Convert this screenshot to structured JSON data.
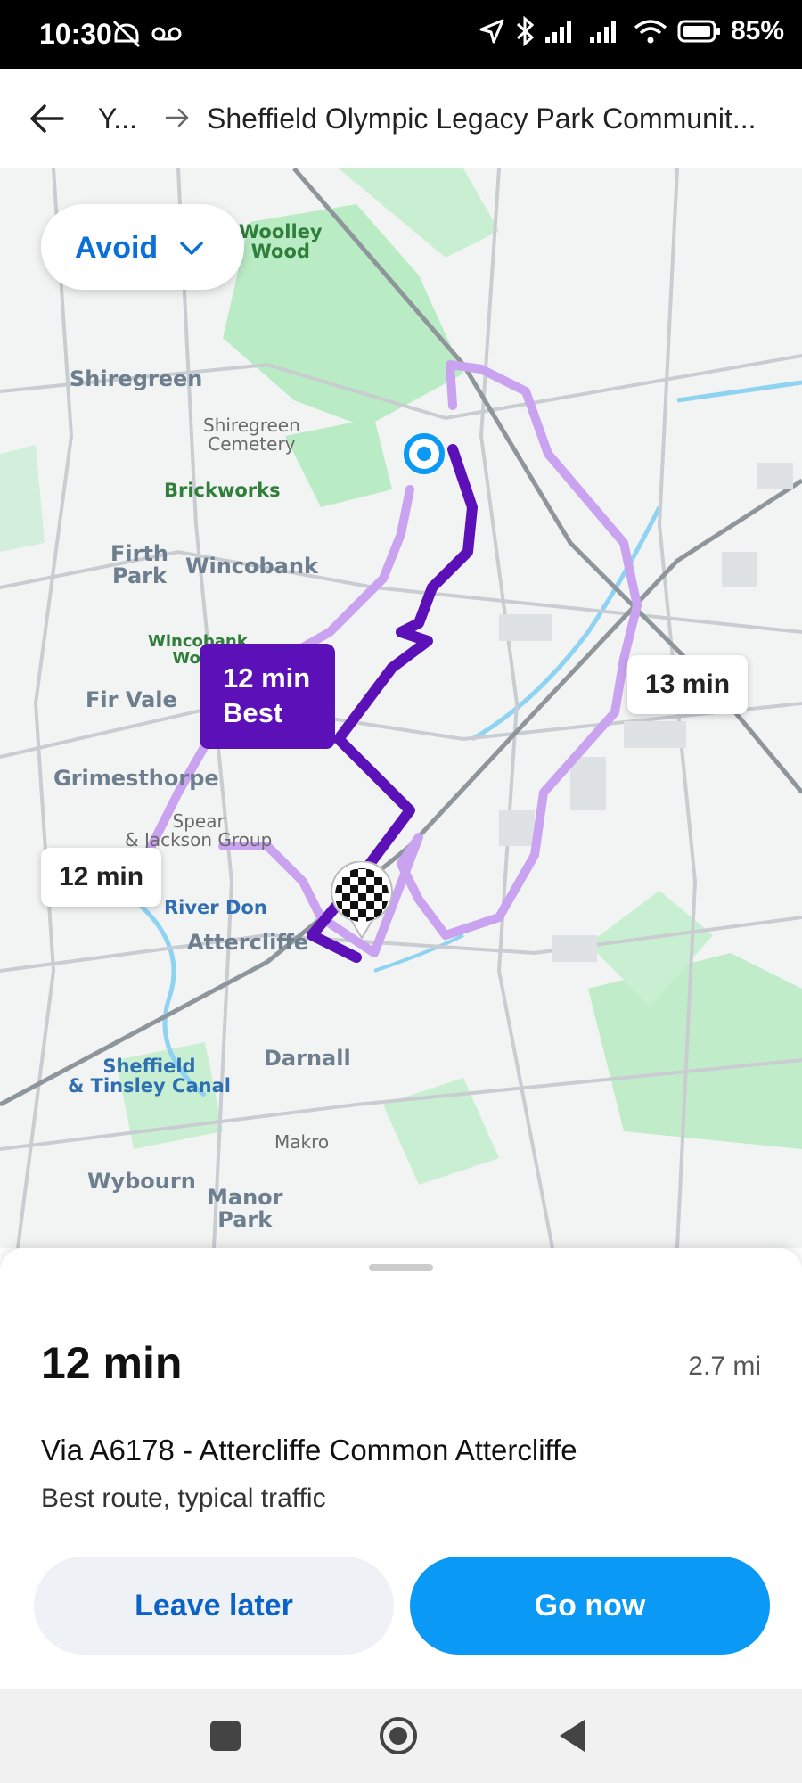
{
  "status_bar": {
    "time": "10:30",
    "battery_percent": "85%",
    "icons": [
      "alarm-off-icon",
      "voicemail-icon",
      "location-arrow-icon",
      "bluetooth-icon",
      "signal-icon",
      "signal-icon",
      "wifi-icon",
      "battery-icon"
    ]
  },
  "header": {
    "origin": "Y...",
    "destination": "Sheffield Olympic Legacy Park Communit..."
  },
  "map": {
    "avoid_label": "Avoid",
    "labels": {
      "woolley_wood": "Woolley\nWood",
      "shiregreen": "Shiregreen",
      "shiregreen_cemetery": "Shiregreen\nCemetery",
      "brickworks": "Brickworks",
      "firth_park": "Firth\nPark",
      "wincobank": "Wincobank",
      "wincobank_wood": "Wincobank\nWood",
      "fir_vale": "Fir Vale",
      "grimesthorpe": "Grimesthorpe",
      "spear_jackson": "Spear\n& Jackson Group",
      "river_don": "River Don",
      "attercliffe": "Attercliffe",
      "sheffield_canal": "Sheffield\n& Tinsley Canal",
      "darnall": "Darnall",
      "makro": "Makro",
      "wybourn": "Wybourn",
      "manor_park": "Manor\nPark"
    },
    "routes": [
      {
        "time": "12 min",
        "tag": "Best",
        "selected": true,
        "color": "#5b10b8"
      },
      {
        "time": "13 min",
        "tag": "",
        "selected": false,
        "color": "#c9a2f0"
      },
      {
        "time": "12 min",
        "tag": "",
        "selected": false,
        "color": "#c9a2f0"
      }
    ]
  },
  "sheet": {
    "duration": "12 min",
    "distance": "2.7 mi",
    "via": "Via A6178 - Attercliffe Common Attercliffe",
    "description": "Best route, typical traffic",
    "leave_later_label": "Leave later",
    "go_now_label": "Go now"
  },
  "colors": {
    "accent": "#0a9af5",
    "accent_text": "#0b63c7",
    "best_route": "#5b10b8",
    "alt_route": "#c9a2f0",
    "park": "#b9ebc4",
    "water": "#8fd3f2"
  }
}
